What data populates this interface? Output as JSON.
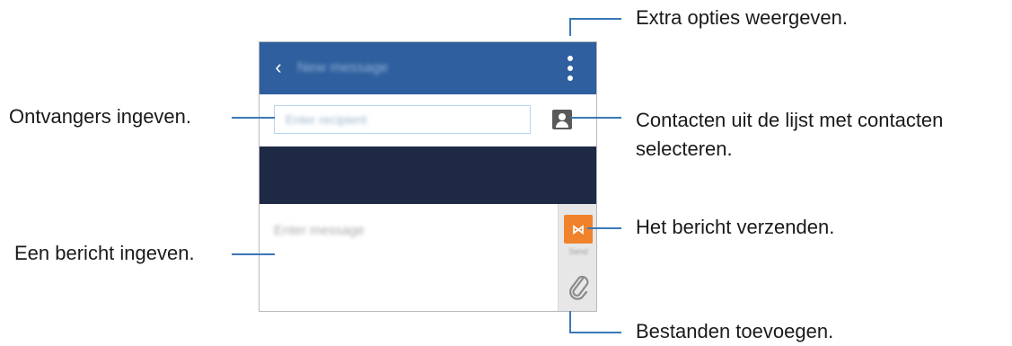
{
  "screen": {
    "appbar": {
      "title": "New message",
      "back_icon": "chevron-left-icon",
      "more_icon": "more-vertical-icon",
      "color": "#2f5f9e"
    },
    "recipient": {
      "placeholder": "Enter recipient",
      "contact_icon": "contact-icon"
    },
    "message": {
      "placeholder": "Enter message"
    },
    "send": {
      "icon": "send-icon",
      "sub_label": "Send",
      "color": "#f0822b"
    },
    "attach": {
      "icon": "paperclip-icon"
    }
  },
  "annotations": {
    "more_options": "Extra opties weergeven.",
    "recipients": "Ontvangers ingeven.",
    "contacts_line1": "Contacten uit de lijst met contacten",
    "contacts_line2": "selecteren.",
    "send": "Het bericht verzenden.",
    "message": "Een bericht ingeven.",
    "attach": "Bestanden toevoegen."
  },
  "colors": {
    "callout_line": "#3a78b8",
    "dark_band": "#1e2a45"
  }
}
